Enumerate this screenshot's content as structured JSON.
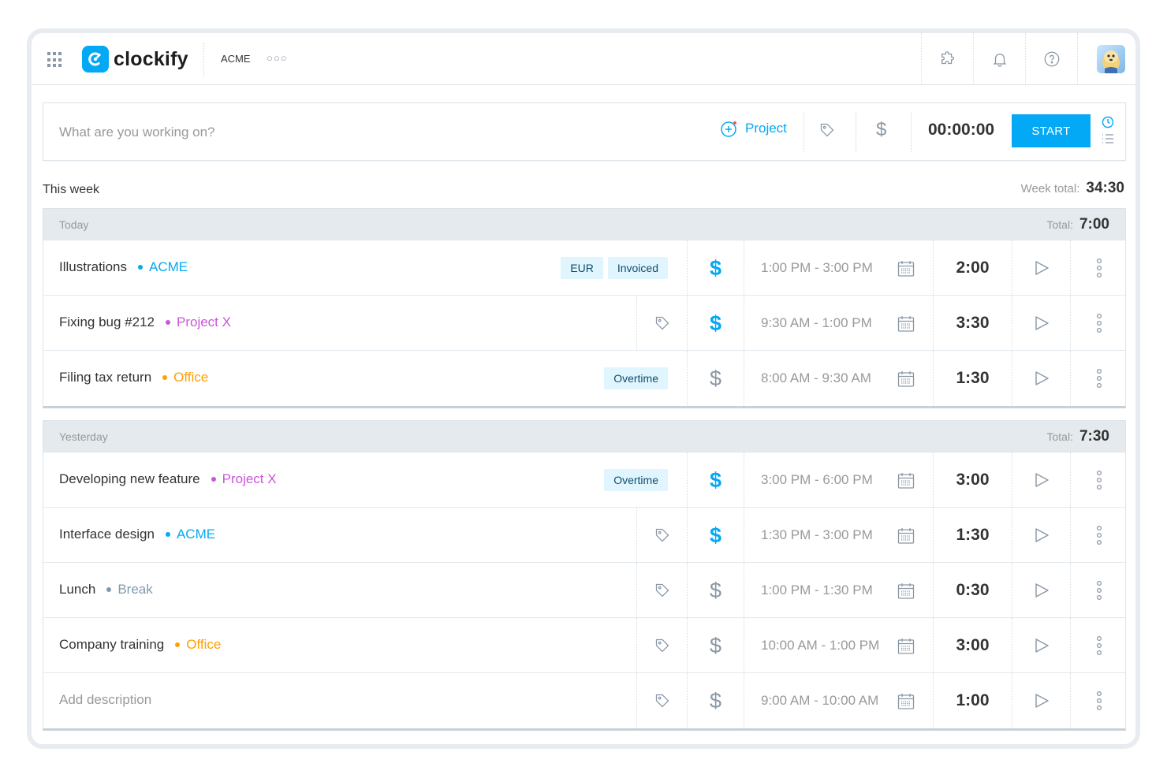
{
  "header": {
    "logo_text": "clockify",
    "workspace": "ACME",
    "workspace_more": "○○○",
    "icons": [
      "apps-grid-icon",
      "extension-icon",
      "bell-icon",
      "help-icon",
      "avatar"
    ]
  },
  "tracker": {
    "placeholder": "What are you working on?",
    "project_label": "Project",
    "timer": "00:00:00",
    "start_label": "START"
  },
  "week": {
    "label": "This week",
    "total_label": "Week total:",
    "total": "34:30"
  },
  "groups": [
    {
      "day": "Today",
      "total_label": "Total:",
      "total": "7:00",
      "entries": [
        {
          "description": "Illustrations",
          "project": "ACME",
          "project_color": "#03a9f4",
          "badges": [
            "EUR",
            "Invoiced"
          ],
          "billable": true,
          "range": "1:00 PM - 3:00 PM",
          "duration": "2:00"
        },
        {
          "description": "Fixing bug #212",
          "project": "Project X",
          "project_color": "#c956d9",
          "badges": [],
          "billable": true,
          "range": "9:30 AM - 1:00 PM",
          "duration": "3:30"
        },
        {
          "description": "Filing tax return",
          "project": "Office",
          "project_color": "#ffa000",
          "badges": [
            "Overtime"
          ],
          "billable": false,
          "range": "8:00 AM - 9:30 AM",
          "duration": "1:30"
        }
      ]
    },
    {
      "day": "Yesterday",
      "total_label": "Total:",
      "total": "7:30",
      "entries": [
        {
          "description": "Developing new feature",
          "project": "Project X",
          "project_color": "#c956d9",
          "badges": [
            "Overtime"
          ],
          "billable": true,
          "range": "3:00 PM - 6:00 PM",
          "duration": "3:00"
        },
        {
          "description": "Interface design",
          "project": "ACME",
          "project_color": "#03a9f4",
          "badges": [],
          "billable": true,
          "range": "1:30 PM - 3:00 PM",
          "duration": "1:30"
        },
        {
          "description": "Lunch",
          "project": "Break",
          "project_color": "#7e9bae",
          "badges": [],
          "billable": false,
          "range": "1:00 PM - 1:30 PM",
          "duration": "0:30"
        },
        {
          "description": "Company training",
          "project": "Office",
          "project_color": "#ffa000",
          "badges": [],
          "billable": false,
          "range": "10:00 AM - 1:00 PM",
          "duration": "3:00"
        },
        {
          "description": "Add description",
          "project": "",
          "project_color": "",
          "badges": [],
          "billable": false,
          "range": "9:00 AM - 10:00 AM",
          "duration": "1:00",
          "placeholder": true
        }
      ]
    }
  ],
  "colors": {
    "accent": "#03a9f4",
    "billable_on": "#03a9f4",
    "billable_off": "#8a98a6"
  }
}
